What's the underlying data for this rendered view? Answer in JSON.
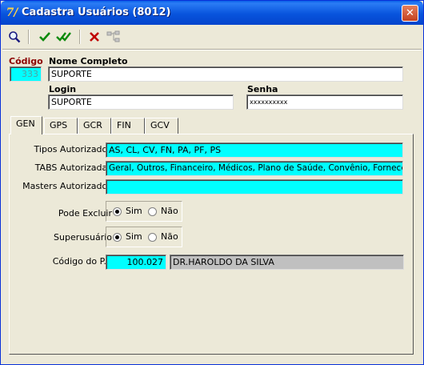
{
  "window": {
    "title": "Cadastra Usuários (8012)",
    "close_glyph": "✕"
  },
  "toolbar": {
    "icons": [
      "search-icon",
      "check-icon",
      "check-all-icon",
      "delete-icon",
      "tree-icon"
    ]
  },
  "form": {
    "codigo_label": "Código",
    "codigo_value": "333",
    "nome_label": "Nome Completo",
    "nome_value": "SUPORTE",
    "login_label": "Login",
    "login_value": "SUPORTE",
    "senha_label": "Senha",
    "senha_value": "xxxxxxxxxx"
  },
  "tabs": [
    "GEN",
    "GPS",
    "GCR",
    "FIN",
    "GCV"
  ],
  "gen": {
    "tipos_label": "Tipos Autorizados",
    "tipos_value": "AS, CL, CV, FN, PA, PF, PS",
    "tabs_label": "TABS Autorizadas",
    "tabs_value": "Geral, Outros, Financeiro, Médicos, Plano de Saúde, Convênio, Fornecedores",
    "masters_label": "Masters Autorizados",
    "masters_value": "",
    "pode_excluir_label": "Pode Excluir",
    "superusuario_label": "Superusuário",
    "sim_label": "Sim",
    "nao_label": "Não",
    "pode_excluir_selected": "Sim",
    "superusuario_selected": "Sim",
    "codigo_ps_label": "Código do P.S",
    "codigo_ps_value": "100.027",
    "codigo_ps_name": "DR.HAROLDO DA SILVA"
  },
  "colors": {
    "title_bar": "#0854dd",
    "field_highlight": "#00ffff",
    "codigo_label": "#8b0000"
  }
}
